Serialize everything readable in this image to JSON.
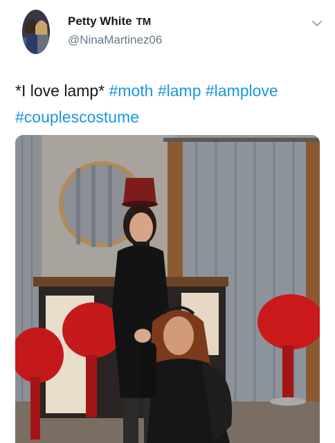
{
  "author": {
    "display_name": "Petty White",
    "tm_mark": "TM",
    "handle": "@NinaMartinez06"
  },
  "tweet": {
    "text": "*I love lamp*",
    "hashtags": [
      "#moth",
      "#lamp",
      "#lamplove",
      "#couplescostume"
    ]
  },
  "icons": {
    "menu": "chevron-down-icon",
    "avatar": "profile-photo"
  },
  "colors": {
    "hashtag": "#1b95e0",
    "handle": "#657786",
    "text": "#14171a"
  }
}
